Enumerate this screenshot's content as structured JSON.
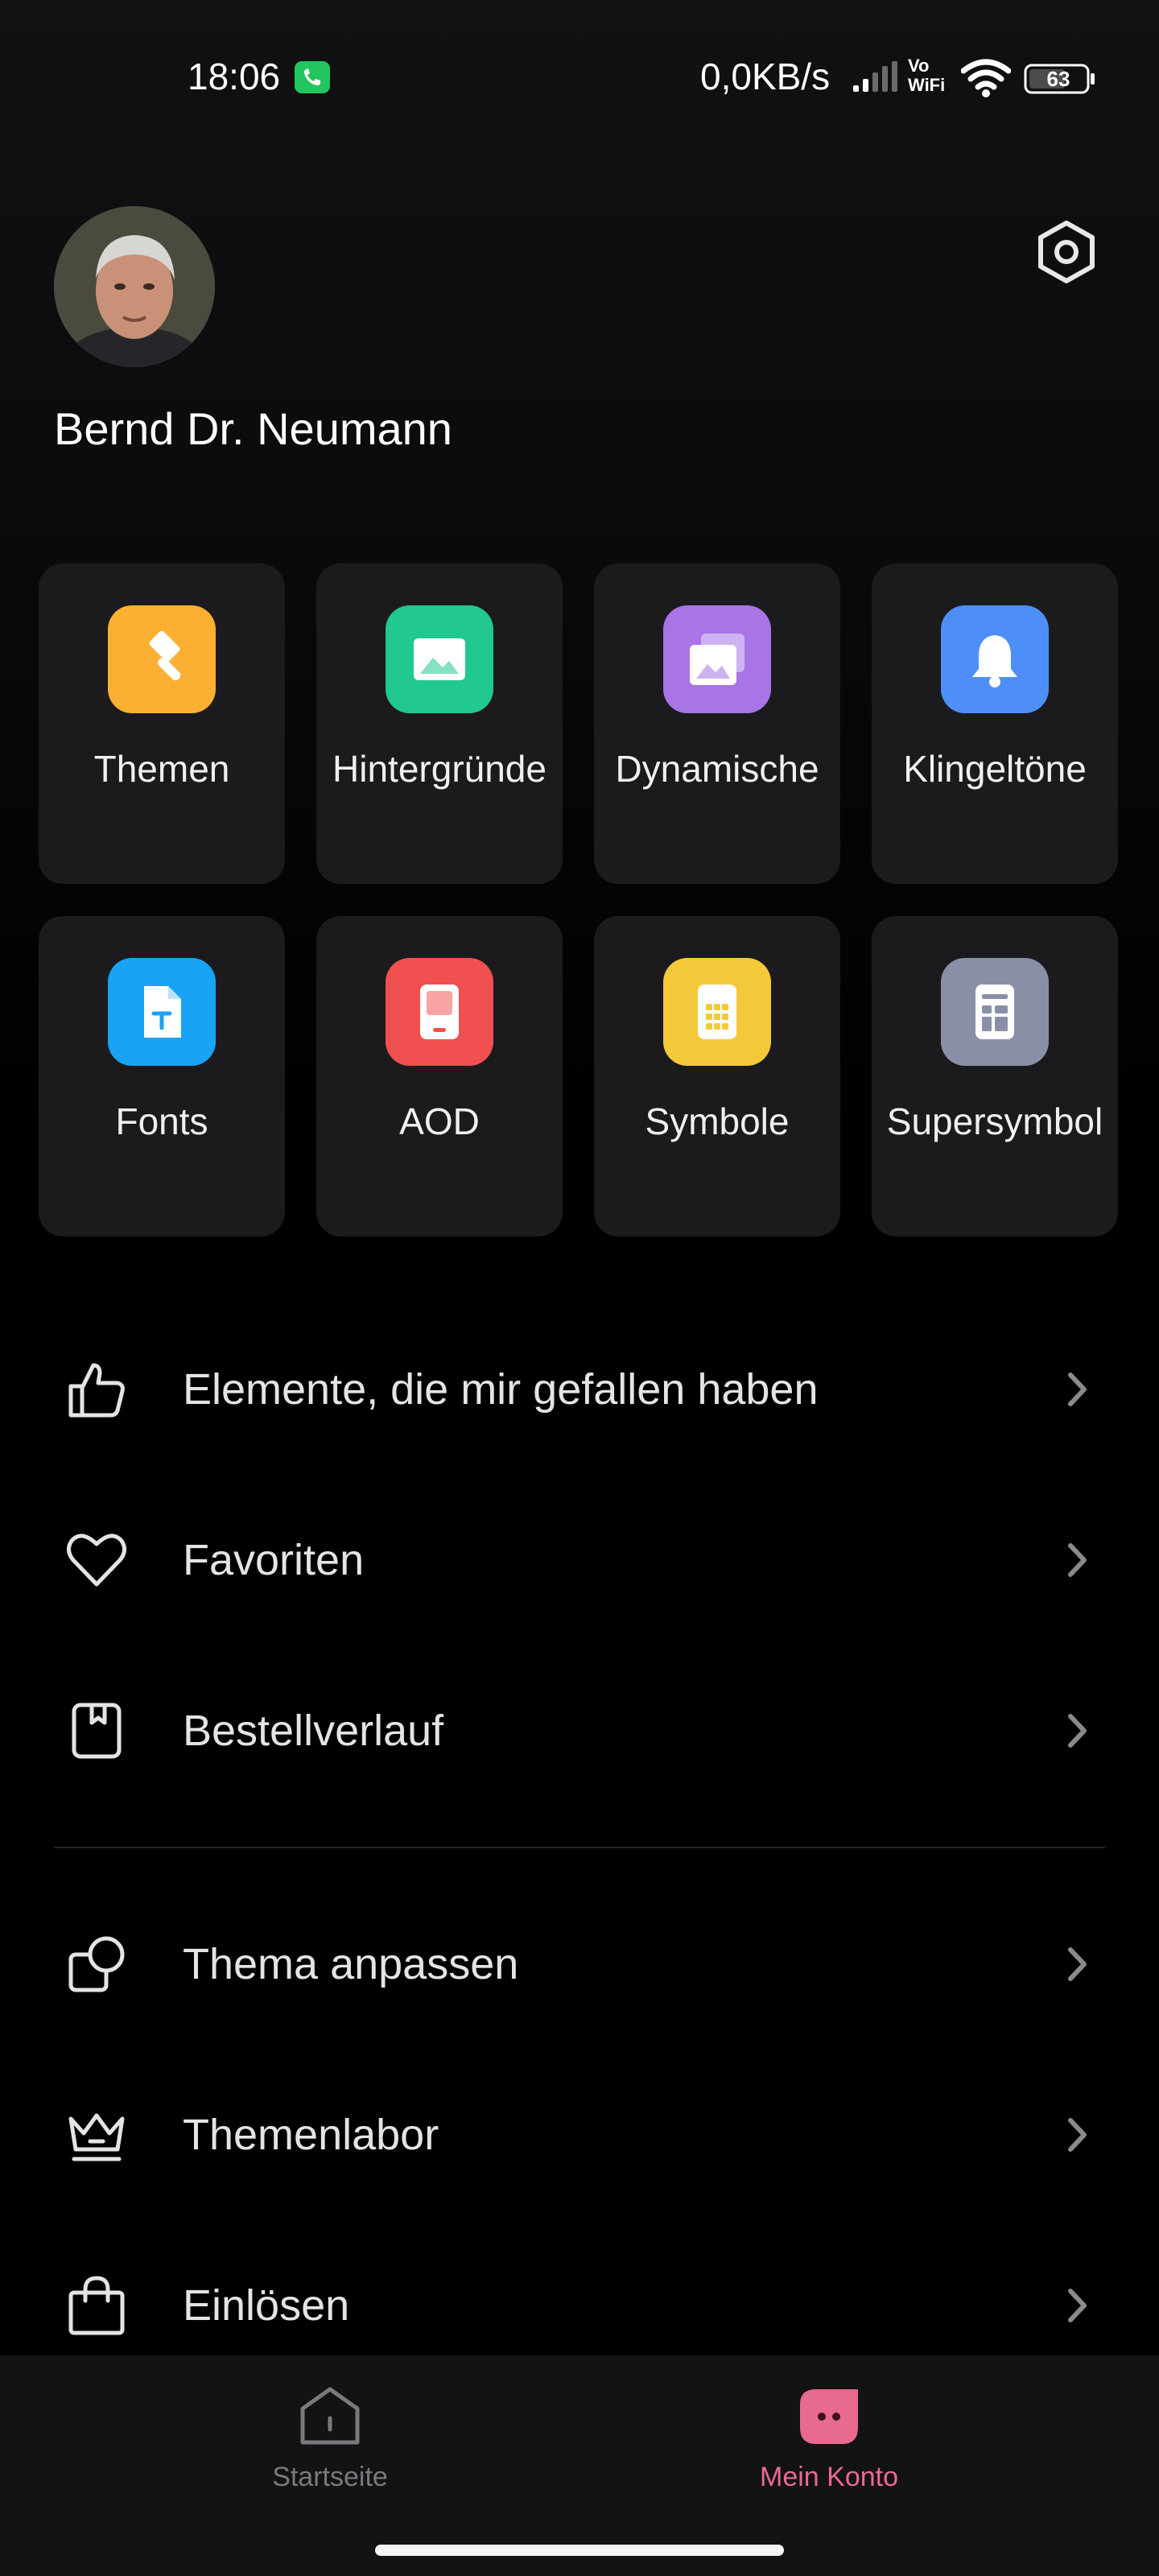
{
  "status_bar": {
    "time": "18:06",
    "network_speed": "0,0KB/s",
    "vowifi_top": "Vo",
    "vowifi_bottom": "WiFi",
    "battery": "63"
  },
  "profile": {
    "name": "Bernd Dr. Neumann"
  },
  "categories": [
    {
      "label": "Themen",
      "icon": "brush-icon",
      "color": "#fbb033"
    },
    {
      "label": "Hintergründe",
      "icon": "image-icon",
      "color": "#21c890"
    },
    {
      "label": "Dynamische",
      "icon": "layered-image-icon",
      "color": "#a874e6"
    },
    {
      "label": "Klingeltöne",
      "icon": "bell-icon",
      "color": "#4d8ff7"
    },
    {
      "label": "Fonts",
      "icon": "font-file-icon",
      "color": "#18a3f5"
    },
    {
      "label": "AOD",
      "icon": "phone-screen-icon",
      "color": "#f0504f"
    },
    {
      "label": "Symbole",
      "icon": "app-grid-icon",
      "color": "#f3c93a"
    },
    {
      "label": "Supersymbol",
      "icon": "widget-icon",
      "color": "#8a8fa8"
    }
  ],
  "menu": [
    {
      "label": "Elemente, die mir gefallen haben",
      "icon": "thumbs-up-icon"
    },
    {
      "label": "Favoriten",
      "icon": "heart-icon"
    },
    {
      "label": "Bestellverlauf",
      "icon": "order-history-icon"
    },
    {
      "label": "Thema anpassen",
      "icon": "customize-theme-icon"
    },
    {
      "label": "Themenlabor",
      "icon": "crown-icon"
    },
    {
      "label": "Einlösen",
      "icon": "shopping-bag-icon"
    }
  ],
  "bottom_nav": {
    "home_label": "Startseite",
    "account_label": "Mein Konto",
    "active_color": "#e86a8e",
    "inactive_color": "#7a7a7e"
  }
}
